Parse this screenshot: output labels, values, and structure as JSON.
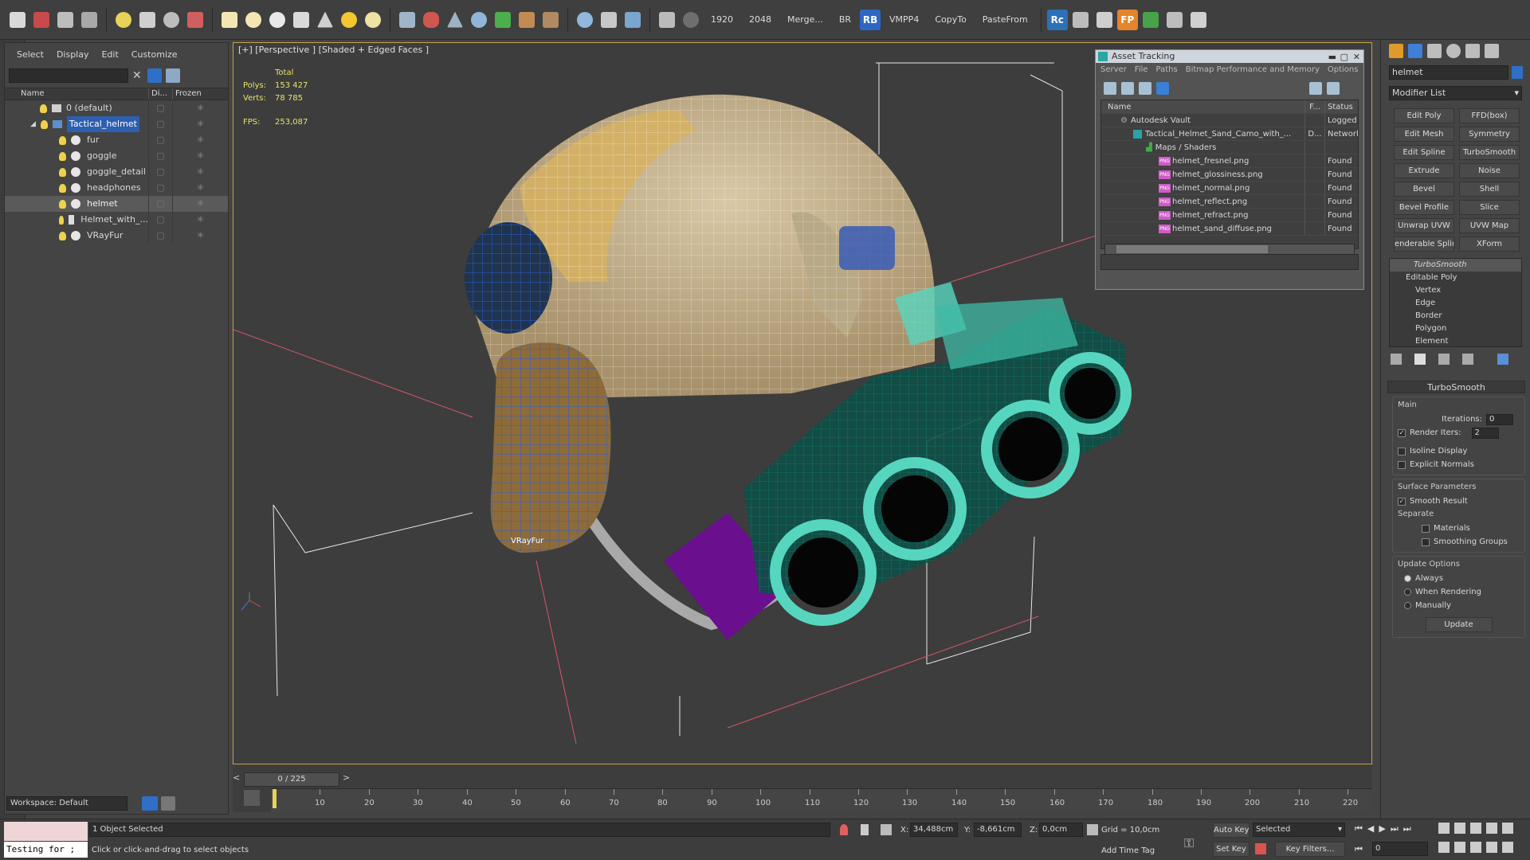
{
  "toolbar": {
    "texts": [
      "1920",
      "2048",
      "Merge...",
      "BR",
      "VMPP4",
      "CopyTo",
      "PasteFrom"
    ],
    "rb_label": "RB",
    "rc_label": "Rc",
    "fp_label": "FP"
  },
  "scene_explorer": {
    "menu": [
      "Select",
      "Display",
      "Edit",
      "Customize"
    ],
    "columns": [
      "Name",
      "Di...",
      "Frozen"
    ],
    "rows": [
      {
        "name": "0 (default)"
      },
      {
        "name": "Tactical_helmet"
      },
      {
        "name": "fur"
      },
      {
        "name": "goggle"
      },
      {
        "name": "goggle_detail"
      },
      {
        "name": "headphones"
      },
      {
        "name": "helmet"
      },
      {
        "name": "Helmet_with_..."
      },
      {
        "name": "VRayFur"
      }
    ],
    "workspace": "Workspace: Default"
  },
  "viewport": {
    "label": "[+] [Perspective ] [Shaded + Edged Faces ]",
    "stats": {
      "total_label": "Total",
      "polys_label": "Polys:",
      "polys": "153 427",
      "verts_label": "Verts:",
      "verts": "78 785",
      "fps_label": "FPS:",
      "fps": "253,087"
    },
    "vrayfur_label": "VRayFur"
  },
  "asset_tracking": {
    "title": "Asset Tracking",
    "menu": [
      "Server",
      "File",
      "Paths",
      "Bitmap Performance and Memory",
      "Options"
    ],
    "columns": [
      "Name",
      "F...",
      "Status"
    ],
    "rows": [
      {
        "name": "Autodesk Vault",
        "f": "",
        "status": "Logged Ou"
      },
      {
        "name": "Tactical_Helmet_Sand_Camo_with_...",
        "f": "D...",
        "status": "Network P"
      },
      {
        "name": "Maps / Shaders",
        "f": "",
        "status": ""
      },
      {
        "name": "helmet_fresnel.png",
        "f": "",
        "status": "Found"
      },
      {
        "name": "helmet_glossiness.png",
        "f": "",
        "status": "Found"
      },
      {
        "name": "helmet_normal.png",
        "f": "",
        "status": "Found"
      },
      {
        "name": "helmet_reflect.png",
        "f": "",
        "status": "Found"
      },
      {
        "name": "helmet_refract.png",
        "f": "",
        "status": "Found"
      },
      {
        "name": "helmet_sand_diffuse.png",
        "f": "",
        "status": "Found"
      }
    ],
    "png_badge": "PNG"
  },
  "command_panel": {
    "object_name": "helmet",
    "modifier_list": "Modifier List",
    "buttons": [
      "Edit Poly",
      "FFD(box)",
      "Edit Mesh",
      "Symmetry",
      "Edit Spline",
      "TurboSmooth",
      "Extrude",
      "Noise",
      "Bevel",
      "Shell",
      "Bevel Profile",
      "Slice",
      "Unwrap UVW",
      "UVW Map",
      "enderable Splin",
      "XForm"
    ],
    "stack": [
      "TurboSmooth",
      "Editable Poly",
      "Vertex",
      "Edge",
      "Border",
      "Polygon",
      "Element"
    ],
    "rollout_title": "TurboSmooth",
    "main_label": "Main",
    "iterations_label": "Iterations:",
    "iterations": "0",
    "render_iters_label": "Render Iters:",
    "render_iters": "2",
    "isoline_label": "Isoline Display",
    "explicit_normals_label": "Explicit Normals",
    "surface_label": "Surface Parameters",
    "smooth_result_label": "Smooth Result",
    "separate_label": "Separate",
    "materials_label": "Materials",
    "smoothing_groups_label": "Smoothing Groups",
    "update_options_label": "Update Options",
    "always_label": "Always",
    "when_rendering_label": "When Rendering",
    "manually_label": "Manually",
    "update_button": "Update"
  },
  "timeline": {
    "frame_display": "0 / 225",
    "ticks": [
      "10",
      "20",
      "30",
      "40",
      "50",
      "60",
      "70",
      "80",
      "90",
      "100",
      "110",
      "120",
      "130",
      "140",
      "150",
      "160",
      "170",
      "180",
      "190",
      "200",
      "210",
      "220"
    ]
  },
  "status_bar": {
    "maxscript": "Testing for ;",
    "selected": "1 Object Selected",
    "prompt": "Click or click-and-drag to select objects",
    "x_label": "X:",
    "x": "34,488cm",
    "y_label": "Y:",
    "y": "-8,661cm",
    "z_label": "Z:",
    "z": "0,0cm",
    "grid": "Grid = 10,0cm",
    "add_time_tag": "Add Time Tag",
    "auto_key": "Auto Key",
    "set_key": "Set Key",
    "selected_dropdown": "Selected",
    "key_filters": "Key Filters...",
    "frame_field": "0"
  }
}
